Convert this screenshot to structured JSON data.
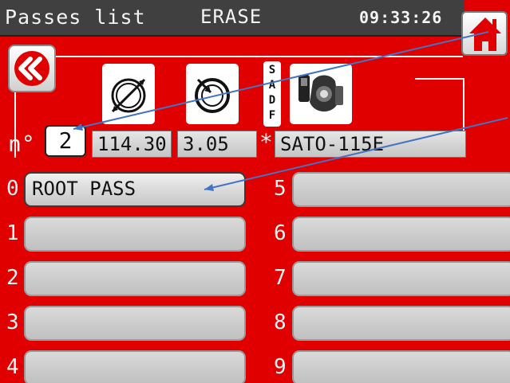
{
  "titlebar": {
    "title": "Passes list",
    "mode": "ERASE",
    "clock": "09:33:26"
  },
  "icons": {
    "home": "home-icon",
    "back": "double-chevron-left-icon",
    "diameter": "tube-diameter-icon",
    "thickness": "wall-thickness-icon",
    "head": "weld-head-icon"
  },
  "position_letters": [
    "S",
    "A",
    "D",
    "F"
  ],
  "info": {
    "n_label": "n°",
    "n_value": "2",
    "diameter": "114.30",
    "thickness": "3.05",
    "star": "*",
    "head": "SATO-115E"
  },
  "passes": [
    {
      "index": "0",
      "label": "ROOT PASS"
    },
    {
      "index": "1",
      "label": ""
    },
    {
      "index": "2",
      "label": ""
    },
    {
      "index": "3",
      "label": ""
    },
    {
      "index": "4",
      "label": ""
    },
    {
      "index": "5",
      "label": ""
    },
    {
      "index": "6",
      "label": ""
    },
    {
      "index": "7",
      "label": ""
    },
    {
      "index": "8",
      "label": ""
    },
    {
      "index": "9",
      "label": ""
    }
  ],
  "colors": {
    "background": "#e00000",
    "titlebar": "#404040",
    "annotation_arrow": "#4472c4"
  }
}
